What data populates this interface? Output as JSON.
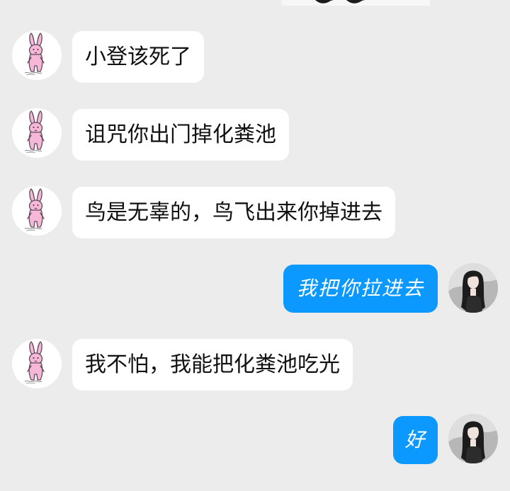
{
  "chat": {
    "messages": [
      {
        "side": "left",
        "text": "小登该死了"
      },
      {
        "side": "left",
        "text": "诅咒你出门掉化粪池"
      },
      {
        "side": "left",
        "text": "鸟是无辜的，鸟飞出来你掉进去"
      },
      {
        "side": "right",
        "text": "我把你拉进去"
      },
      {
        "side": "left",
        "text": "我不怕，我能把化粪池吃光"
      },
      {
        "side": "right",
        "text": "好"
      }
    ]
  },
  "icons": {
    "left_avatar": "pink-bunny-avatar-icon",
    "right_avatar": "dark-haired-girl-avatar-icon"
  },
  "colors": {
    "background": "#ececec",
    "incoming_bubble": "#ffffff",
    "outgoing_bubble": "#0b99ff",
    "outgoing_text": "#ffffff",
    "incoming_text": "#111111"
  }
}
